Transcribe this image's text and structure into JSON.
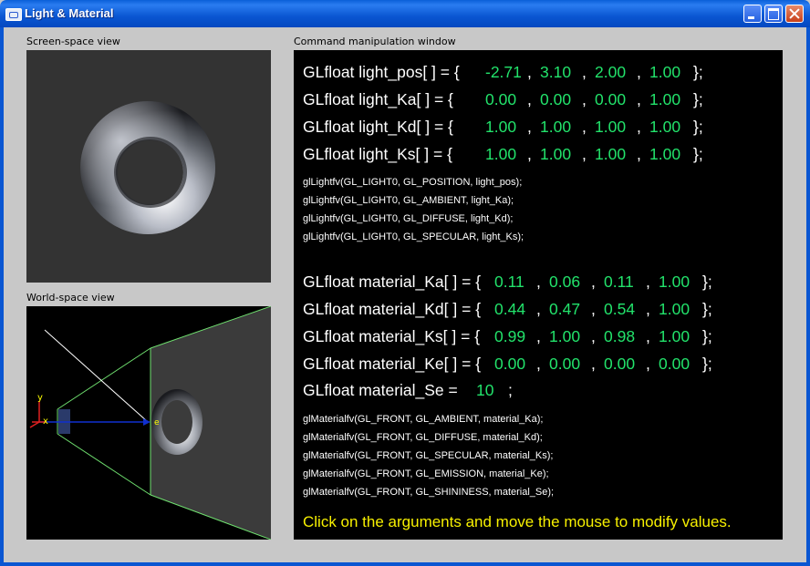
{
  "window": {
    "title": "Light & Material"
  },
  "screen_view": {
    "label": "Screen-space view"
  },
  "world_view": {
    "label": "World-space view",
    "axis_y": "y",
    "axis_x": "x",
    "light_marker": "e"
  },
  "command_window": {
    "label": "Command manipulation window",
    "light_rows": [
      {
        "name": "GLfloat light_pos[ ] = {",
        "values": [
          "-2.71",
          "3.10",
          "2.00",
          "1.00"
        ]
      },
      {
        "name": "GLfloat light_Ka[ ] = {",
        "values": [
          "0.00",
          "0.00",
          "0.00",
          "1.00"
        ]
      },
      {
        "name": "GLfloat light_Kd[ ] = {",
        "values": [
          "1.00",
          "1.00",
          "1.00",
          "1.00"
        ]
      },
      {
        "name": "GLfloat light_Ks[ ] = {",
        "values": [
          "1.00",
          "1.00",
          "1.00",
          "1.00"
        ]
      }
    ],
    "light_calls": [
      "glLightfv(GL_LIGHT0, GL_POSITION, light_pos);",
      "glLightfv(GL_LIGHT0, GL_AMBIENT, light_Ka);",
      "glLightfv(GL_LIGHT0, GL_DIFFUSE, light_Kd);",
      "glLightfv(GL_LIGHT0, GL_SPECULAR, light_Ks);"
    ],
    "material_rows": [
      {
        "name": "GLfloat material_Ka[ ] = {",
        "values": [
          "0.11",
          "0.06",
          "0.11",
          "1.00"
        ]
      },
      {
        "name": "GLfloat material_Kd[ ] = {",
        "values": [
          "0.44",
          "0.47",
          "0.54",
          "1.00"
        ]
      },
      {
        "name": "GLfloat material_Ks[ ] = {",
        "values": [
          "0.99",
          "1.00",
          "0.98",
          "1.00"
        ]
      },
      {
        "name": "GLfloat material_Ke[ ] = {",
        "values": [
          "0.00",
          "0.00",
          "0.00",
          "0.00"
        ]
      }
    ],
    "shininess": {
      "name": "GLfloat material_Se =",
      "value": "10",
      "end": ";"
    },
    "material_calls": [
      "glMaterialfv(GL_FRONT, GL_AMBIENT, material_Ka);",
      "glMaterialfv(GL_FRONT, GL_DIFFUSE, material_Kd);",
      "glMaterialfv(GL_FRONT, GL_SPECULAR, material_Ks);",
      "glMaterialfv(GL_FRONT, GL_EMISSION, material_Ke);",
      "glMaterialfv(GL_FRONT, GL_SHININESS, material_Se);"
    ],
    "separator": ",",
    "closing": "};",
    "hint": "Click on the arguments and move the mouse to modify values."
  },
  "colors": {
    "value_green": "#22e36b",
    "hint_yellow": "#f7f000",
    "frustum_green": "#6fe06f",
    "titlebar_blue": "#0a56d2"
  }
}
